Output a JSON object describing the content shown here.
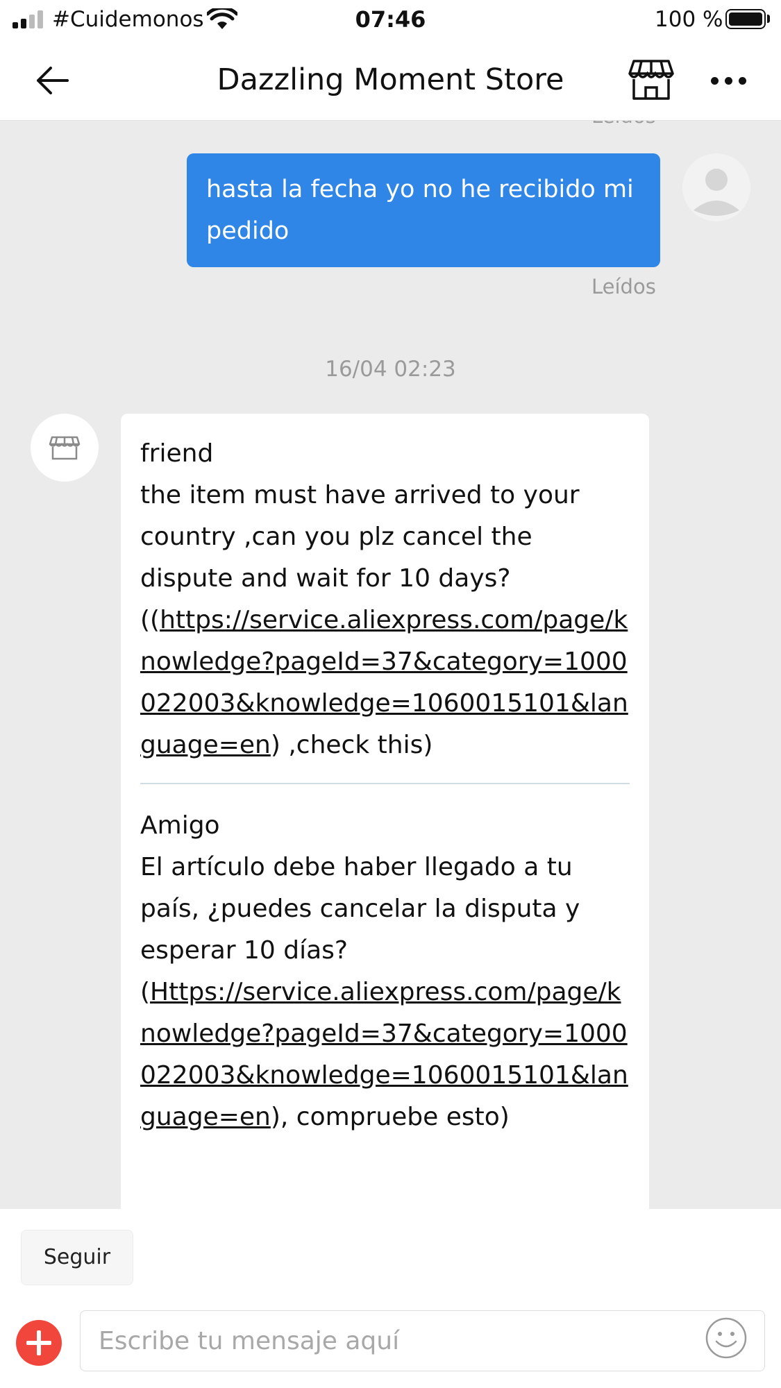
{
  "status_bar": {
    "carrier": "#Cuidemonos",
    "time": "07:46",
    "battery_pct": "100 %"
  },
  "header": {
    "title": "Dazzling Moment Store",
    "back_icon": "arrow-left-icon",
    "store_icon": "store-icon",
    "more_icon": "more-dots-icon"
  },
  "chat": {
    "read_label_top": "Leídos",
    "my_message": {
      "text": "hasta la fecha yo no he recibido mi pedido",
      "status": "Leídos",
      "bubble_color": "#2f86e6"
    },
    "timestamp": "16/04 02:23",
    "store_message": {
      "en": {
        "greeting": "friend",
        "body": "the item must have arrived to your country ,can you plz cancel the dispute and wait for 10 days?",
        "prefix": "((",
        "link": "https://service.aliexpress.com/page/knowledge?pageId=37&category=1000022003&knowledge=1060015101&language=en",
        "suffix": ") ,check this)"
      },
      "es": {
        "greeting": "Amigo",
        "body": "El artículo debe haber llegado a tu país, ¿puedes cancelar la disputa y esperar 10 días?",
        "prefix": "(",
        "link": "Https://service.aliexpress.com/page/knowledge?pageId=37&category=1000022003&knowledge=1060015101&language=en",
        "suffix": "), compruebe esto)"
      }
    }
  },
  "bottom_bar": {
    "follow_label": "Seguir",
    "input_placeholder": "Escribe tu mensaje aquí",
    "input_value": "",
    "plus_color": "#f0463b",
    "emoji_icon": "emoji-smile-icon"
  }
}
